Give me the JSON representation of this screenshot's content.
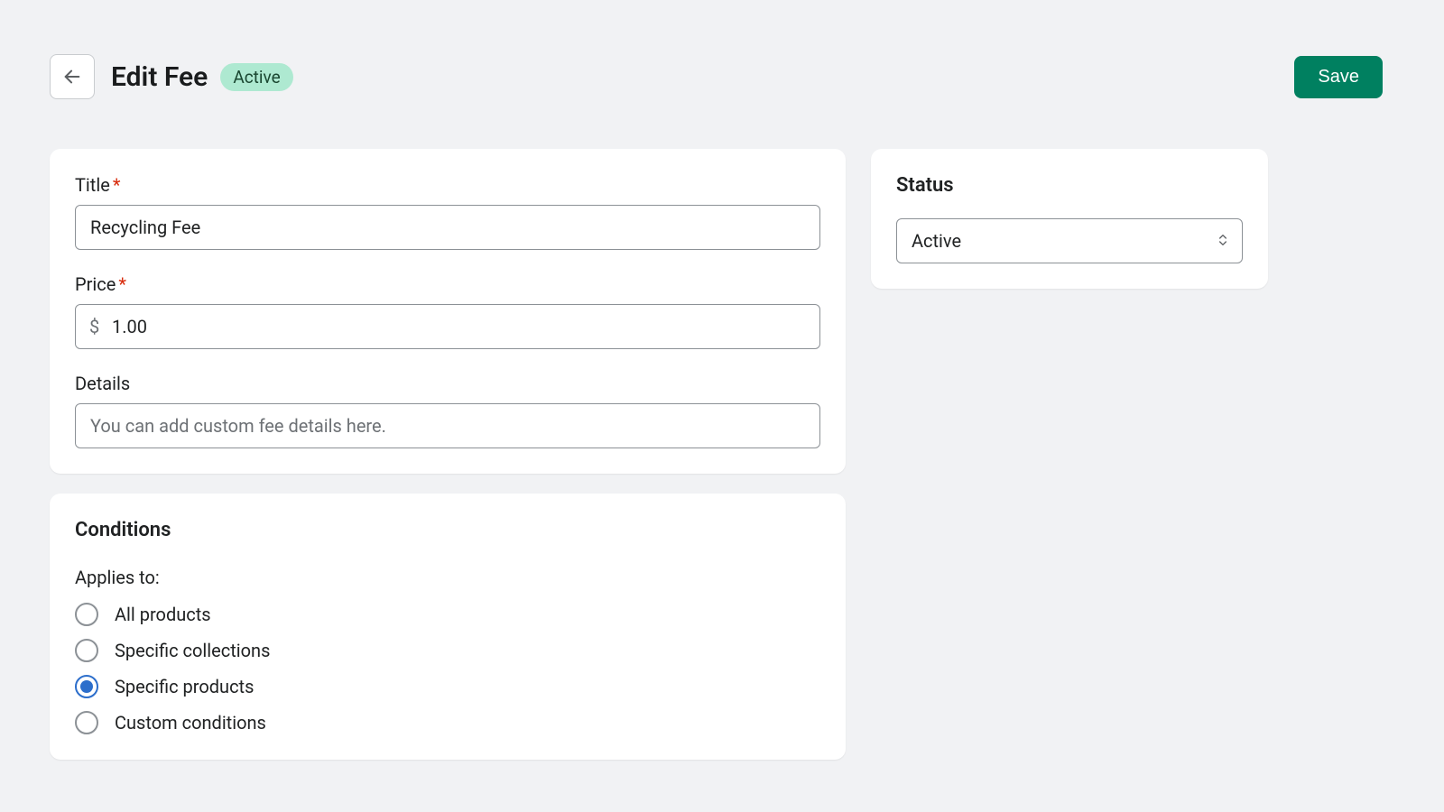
{
  "header": {
    "page_title": "Edit Fee",
    "badge": "Active",
    "save_label": "Save"
  },
  "form": {
    "title": {
      "label": "Title",
      "value": "Recycling Fee"
    },
    "price": {
      "label": "Price",
      "currency": "$",
      "value": "1.00"
    },
    "details": {
      "label": "Details",
      "placeholder": "You can add custom fee details here."
    }
  },
  "conditions": {
    "title": "Conditions",
    "applies_to_label": "Applies to:",
    "options": [
      {
        "label": "All products",
        "selected": false
      },
      {
        "label": "Specific collections",
        "selected": false
      },
      {
        "label": "Specific products",
        "selected": true
      },
      {
        "label": "Custom conditions",
        "selected": false
      }
    ]
  },
  "status": {
    "title": "Status",
    "value": "Active"
  }
}
